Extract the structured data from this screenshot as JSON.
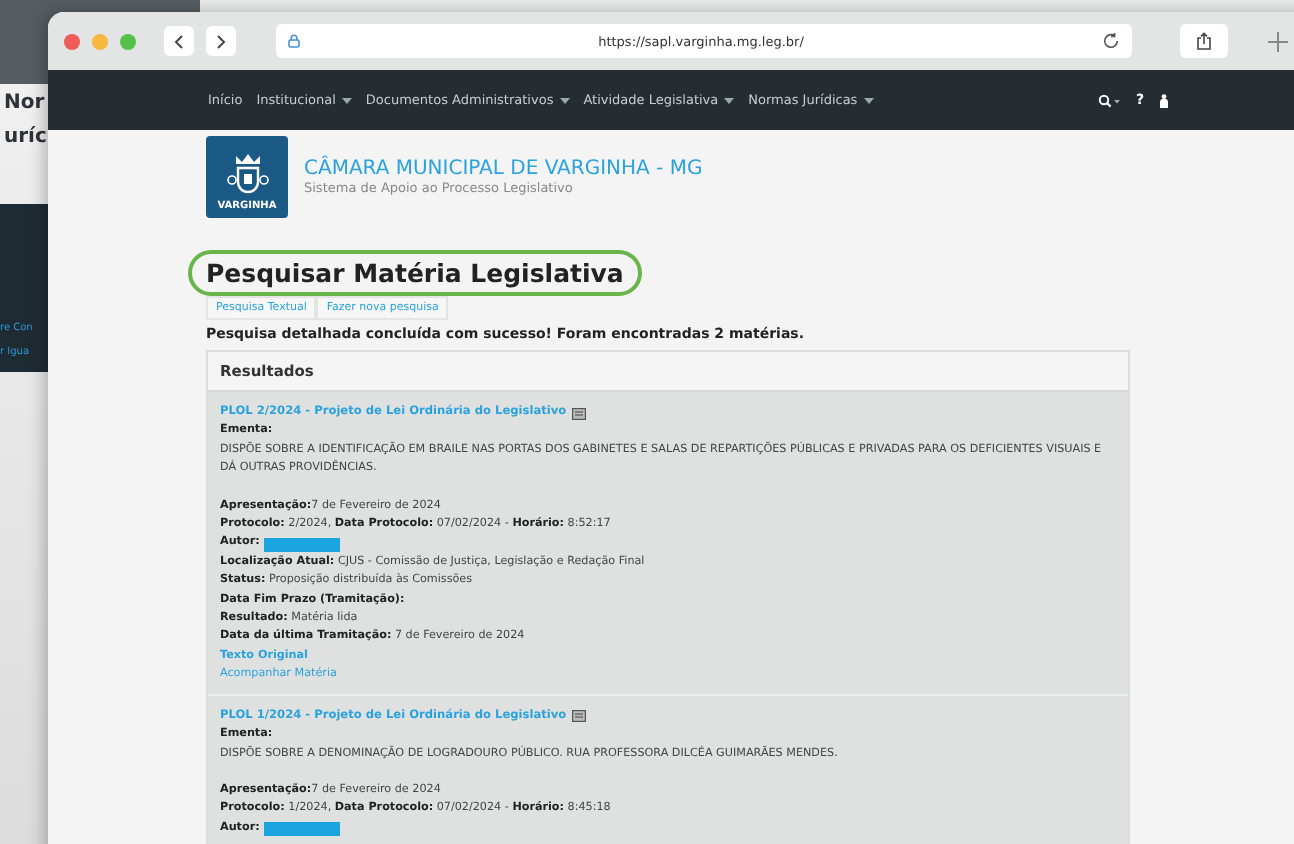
{
  "background_page": {
    "texts": [
      "Nor",
      "uríc"
    ],
    "dark_panel_texts": [
      "re Con",
      "r Igua"
    ]
  },
  "browser": {
    "url": "https://sapl.varginha.mg.leg.br/"
  },
  "nav": {
    "items": [
      {
        "label": "Início",
        "dropdown": false
      },
      {
        "label": "Institucional",
        "dropdown": true
      },
      {
        "label": "Documentos Administrativos",
        "dropdown": true
      },
      {
        "label": "Atividade Legislativa",
        "dropdown": true
      },
      {
        "label": "Normas Jurídicas",
        "dropdown": true
      }
    ],
    "help": "?"
  },
  "header": {
    "logo_text": "VARGINHA",
    "title": "CÂMARA MUNICIPAL DE VARGINHA - MG",
    "subtitle": "Sistema de Apoio ao Processo Legislativo"
  },
  "page_title": "Pesquisar Matéria Legislativa",
  "tabs": [
    {
      "label": "Pesquisa Textual",
      "selected": false
    },
    {
      "label": "Fazer nova pesquisa",
      "selected": false
    }
  ],
  "message": "Pesquisa detalhada concluída com sucesso! Foram encontradas 2 matérias.",
  "results": {
    "heading": "Resultados",
    "items": [
      {
        "title": "PLOL 2/2024 - Projeto de Lei Ordinária do Legislativo",
        "ementa_label": "Ementa:",
        "ementa": "DISPÕE SOBRE A IDENTIFICAÇÃO EM BRAILE NAS PORTAS DOS GABINETES E SALAS DE REPARTIÇÕES PÚBLICAS E PRIVADAS PARA OS DEFICIENTES VISUAIS E DÁ OUTRAS PROVIDÊNCIAS.",
        "fields": [
          {
            "text": "**Apresentação:**7 de Fevereiro de 2024",
            "redacted": false
          },
          {
            "text": "**Protocolo:** 2/2024, **Data Protocolo:** 07/02/2024 - **Horário:** 8:52:17",
            "redacted": false
          },
          {
            "text": "**Autor:**",
            "redacted": true
          },
          {
            "text": "**Localização Atual:** CJUS - Comissão de Justiça, Legislação e Redação Final",
            "redacted": false
          },
          {
            "text": "**Status:** Proposição distribuída às Comissões",
            "redacted": false
          },
          {
            "text": "**Data Fim Prazo (Tramitação):**",
            "redacted": false
          },
          {
            "text": "**Resultado:** Matéria lida",
            "redacted": false
          },
          {
            "text": "**Data da última Tramitação:** 7 de Fevereiro de 2024",
            "redacted": false
          }
        ],
        "links": [
          {
            "label": "Texto Original",
            "bold": true
          },
          {
            "label": "Acompanhar Matéria",
            "bold": false
          }
        ]
      },
      {
        "title": "PLOL 1/2024 - Projeto de Lei Ordinária do Legislativo",
        "ementa_label": "Ementa:",
        "ementa": "DISPÕE SOBRE A DENOMINAÇÃO DE LOGRADOURO PÚBLICO. RUA PROFESSORA DILCÉA GUIMARÃES MENDES.",
        "fields": [
          {
            "text": "**Apresentação:**7 de Fevereiro de 2024",
            "redacted": false
          },
          {
            "text": "**Protocolo:** 1/2024, **Data Protocolo:** 07/02/2024 - **Horário:** 8:45:18",
            "redacted": false
          },
          {
            "text": "**Autor:**",
            "redacted": true
          }
        ]
      }
    ]
  }
}
